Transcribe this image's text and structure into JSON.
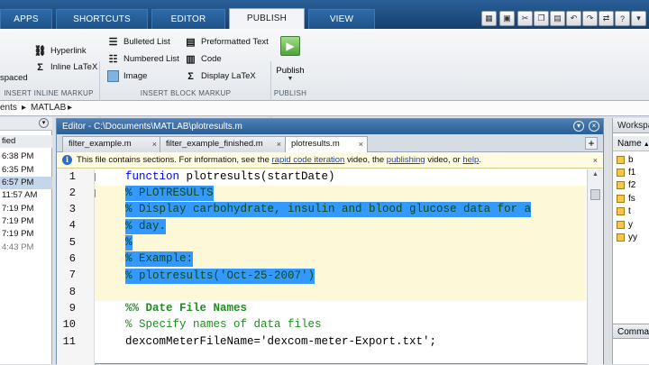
{
  "tabs": [
    {
      "label": "APPS"
    },
    {
      "label": "SHORTCUTS"
    },
    {
      "label": "EDITOR"
    },
    {
      "label": "PUBLISH"
    },
    {
      "label": "VIEW"
    }
  ],
  "ribbon": {
    "spaced_label": "spaced",
    "hyperlink": "Hyperlink",
    "inline_latex": "Inline LaTeX",
    "bulleted_list": "Bulleted List",
    "numbered_list": "Numbered List",
    "image": "Image",
    "preformatted_text": "Preformatted Text",
    "code": "Code",
    "display_latex": "Display LaTeX",
    "publish": "Publish",
    "group_inline": "INSERT INLINE MARKUP",
    "group_block": "INSERT BLOCK MARKUP",
    "group_publish": "PUBLISH"
  },
  "path": {
    "prefix": "ents",
    "folder": "MATLAB"
  },
  "left_pane": {
    "header": "fied",
    "times": [
      "6:38 PM",
      "6:35 PM",
      "6:57 PM",
      "11:57 AM",
      "7:19 PM",
      "7:19 PM",
      "7:19 PM",
      "4:43 PM"
    ]
  },
  "editor": {
    "title": "Editor - C:\\Documents\\MATLAB\\plotresults.m",
    "file_tabs": [
      "filter_example.m",
      "filter_example_finished.m",
      "plotresults.m"
    ],
    "info": {
      "before": "This file contains sections. For information, see the ",
      "link1": "rapid code iteration",
      "mid1": " video, the ",
      "link2": "publishing",
      "mid2": " video, or ",
      "link3": "help",
      "end": "."
    },
    "line_numbers": [
      "1",
      "2",
      "3",
      "4",
      "5",
      "6",
      "7",
      "8",
      "9",
      "10",
      "11"
    ],
    "code": {
      "l1_kw": "function",
      "l1_rest": " plotresults(startDate)",
      "l2": "% PLOTRESULTS",
      "l3": "% Display carbohydrate, insulin and blood glucose data for a",
      "l4": "% day.",
      "l5": "%",
      "l6": "% Example:",
      "l7": "% plotresults('Oct-25-2007')",
      "l9": "%% Date File Names",
      "l10": "% Specify names of data files",
      "l11": "dexcomMeterFileName='dexcom-meter-Export.txt';"
    }
  },
  "workspace": {
    "title": "Workspace",
    "col_header": "Name",
    "vars": [
      "b",
      "f1",
      "f2",
      "fs",
      "t",
      "y",
      "yy"
    ],
    "command_title": "Command Window"
  }
}
